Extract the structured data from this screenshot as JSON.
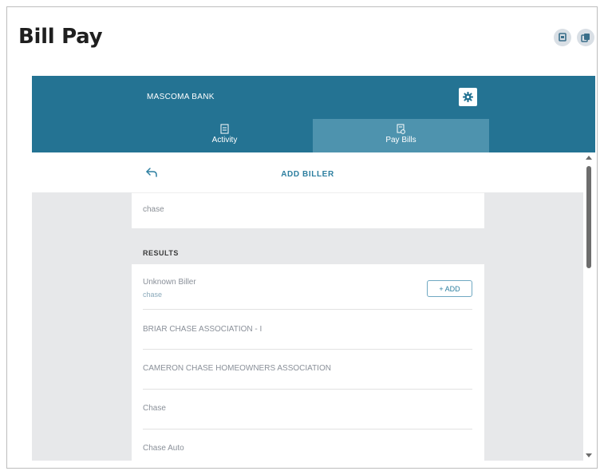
{
  "page": {
    "title": "Bill Pay"
  },
  "title_actions": [
    {
      "icon": "print-icon"
    },
    {
      "icon": "copy-icon"
    }
  ],
  "bank": {
    "name": "MASCOMA BANK",
    "settings_icon": "gear-icon"
  },
  "tabs": [
    {
      "label": "Activity",
      "icon": "document-icon",
      "active": false
    },
    {
      "label": "Pay Bills",
      "icon": "bill-icon",
      "active": true
    }
  ],
  "add_biller": {
    "title": "ADD BILLER",
    "back_icon": "back-arrow-icon"
  },
  "search": {
    "value": "chase"
  },
  "results": {
    "label": "RESULTS",
    "items": [
      {
        "name": "Unknown Biller",
        "sub": "chase",
        "action": "+ ADD"
      },
      {
        "name": "BRIAR CHASE ASSOCIATION - I"
      },
      {
        "name": "CAMERON CHASE HOMEOWNERS ASSOCIATION"
      },
      {
        "name": "Chase"
      },
      {
        "name": "Chase Auto"
      }
    ]
  },
  "colors": {
    "brand": "#247393",
    "active_tab": "#4e93ae",
    "content_bg": "#e7e8ea",
    "accent_text": "#2d7fa0"
  }
}
